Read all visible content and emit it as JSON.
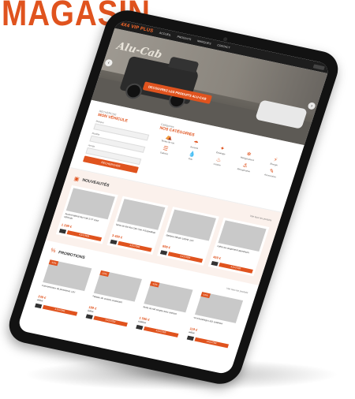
{
  "headline": "MAGASIN",
  "site": {
    "logo": "4X4 VIP PLUS",
    "nav_items": [
      "ACCUEIL",
      "PRODUITS",
      "MARQUES",
      "CONTACT"
    ],
    "hero": {
      "brand": "Alu-Cab",
      "cta": "DECOUVREZ LES PRODUITS ALU-CAB"
    },
    "search": {
      "subtitle": "RECHERCHE",
      "title": "MON VÉHICULE",
      "fields": [
        "Marque",
        "Modèle",
        "Année"
      ],
      "button": "RECHERCHER"
    },
    "categories": {
      "subtitle": "Catégories",
      "title": "NOS CATÉGORIES",
      "items": [
        {
          "icon": "roof-tent-icon",
          "glyph": "⛺",
          "label": "Tentes de toit"
        },
        {
          "icon": "awning-icon",
          "glyph": "☂",
          "label": "Auvents"
        },
        {
          "icon": "light-icon",
          "glyph": "✦",
          "label": "Éclairage"
        },
        {
          "icon": "fridge-icon",
          "glyph": "❄",
          "label": "Réfrigérateurs"
        },
        {
          "icon": "power-icon",
          "glyph": "⚡",
          "label": "Énergie"
        },
        {
          "icon": "rack-icon",
          "glyph": "☰",
          "label": "Galeries"
        },
        {
          "icon": "water-icon",
          "glyph": "💧",
          "label": "Eau"
        },
        {
          "icon": "kitchen-icon",
          "glyph": "♨",
          "label": "Cuisine"
        },
        {
          "icon": "recovery-icon",
          "glyph": "⚓",
          "label": "Récupération"
        },
        {
          "icon": "tools-icon",
          "glyph": "✎",
          "label": "Accessoires"
        }
      ]
    },
    "sections": [
      {
        "subtitle": "Produits",
        "title": "NOUVEAUTÉS",
        "link": "Voir tous les produits",
        "products": [
          {
            "name": "Auvent latéral Alu-Cab 270° pour véhicule",
            "price": "1 299 €",
            "old": "",
            "badge": ""
          },
          {
            "name": "Tente de toit Alu-Cab Gen 3 Expedition",
            "price": "3 490 €",
            "old": "",
            "badge": ""
          },
          {
            "name": "Batterie lithium 100Ah 12V",
            "price": "899 €",
            "old": "",
            "badge": ""
          },
          {
            "name": "Coffre de rangement aluminium",
            "price": "459 €",
            "old": "",
            "badge": ""
          }
        ]
      },
      {
        "subtitle": "Produits",
        "title": "PROMOTIONS",
        "link": "Voir tous les produits",
        "products": [
          {
            "name": "Convertisseur de puissance 12V",
            "price": "249 €",
            "old": "299 €",
            "badge": "-15%"
          },
          {
            "name": "Plateau de cuisine coulissant",
            "price": "189 €",
            "old": "229 €",
            "badge": "-15%"
          },
          {
            "name": "Tente de toit souple avec annexe",
            "price": "1 590 €",
            "old": "1 890 €",
            "badge": "-15%"
          },
          {
            "name": "Kit d'éclairage LED extérieur",
            "price": "119 €",
            "old": "139 €",
            "badge": "-15%"
          }
        ]
      }
    ],
    "buy_label": "AJOUTER"
  },
  "colors": {
    "accent": "#e0531e",
    "nav": "#1d1d1d",
    "tint": "#fbf1ec"
  }
}
